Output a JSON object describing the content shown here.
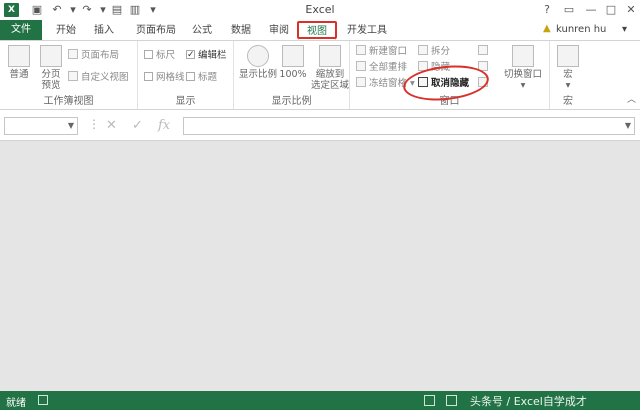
{
  "title_bar": {
    "app_icon": "X",
    "title": "Excel",
    "qa_icons": [
      "save-icon",
      "undo-icon",
      "redo-icon",
      "customize-icon"
    ],
    "window_controls": [
      "?",
      "▭",
      "—",
      "□",
      "✕"
    ]
  },
  "tabs": [
    {
      "label": "文件"
    },
    {
      "label": "开始"
    },
    {
      "label": "插入"
    },
    {
      "label": "页面布局"
    },
    {
      "label": "公式"
    },
    {
      "label": "数据"
    },
    {
      "label": "审阅"
    },
    {
      "label": "视图",
      "active": true
    },
    {
      "label": "开发工具"
    }
  ],
  "user": {
    "name": "kunren hu",
    "caret": "▾"
  },
  "ribbon": {
    "workbook_views": {
      "label": "工作簿视图",
      "normal": "普通",
      "page_break": [
        "分页",
        "预览"
      ],
      "page_layout": "页面布局",
      "custom_views": "自定义视图"
    },
    "show": {
      "label": "显示",
      "ruler": "标尺",
      "formula_bar": "编辑栏",
      "gridlines": "网格线",
      "headings": "标题"
    },
    "zoom": {
      "label": "显示比例",
      "zoom": "显示比例",
      "hundred": "100%",
      "zoom_selection": [
        "缩放到",
        "选定区域"
      ]
    },
    "window": {
      "label": "窗口",
      "new_window": "新建窗口",
      "arrange_all": "全部重排",
      "freeze_panes": "冻结窗格",
      "split": "拆分",
      "hide": "隐藏",
      "unhide": "取消隐藏",
      "switch_windows": "切换窗口"
    },
    "macros": {
      "label": "宏",
      "macros": "宏"
    }
  },
  "formula_bar": {
    "cancel": "✕",
    "enter": "✓",
    "fx": "fx",
    "value": ""
  },
  "status": {
    "ready": "就绪",
    "watermark": "头条号 / Excel自学成才"
  },
  "colors": {
    "accent": "#217346",
    "highlight": "#d9302a",
    "workspace": "#e5e5e5"
  }
}
